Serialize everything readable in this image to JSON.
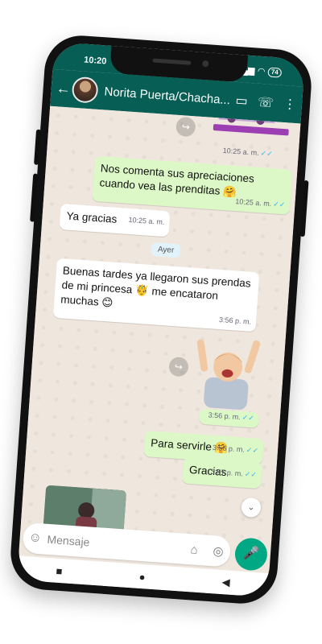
{
  "status": {
    "time": "10:20",
    "battery": "74"
  },
  "header": {
    "title": "Norita Puerta/Chacha..."
  },
  "messages": [
    {
      "text": "",
      "time": "10:25 a. m.",
      "ticks": "✓✓"
    },
    {
      "text": "Nos comenta sus apreciaciones cuando vea las prenditas 🤗",
      "time": "10:25 a. m.",
      "ticks": "✓✓"
    },
    {
      "text": "Ya gracias",
      "time": "10:25 a. m."
    },
    {
      "text": "Buenas tardes ya llegaron sus prendas de mi princesa 🤴 me encataron muchas 😊",
      "time": "3:56 p. m."
    },
    {
      "text": "",
      "time": "3:56 p. m.",
      "ticks": "✓✓"
    },
    {
      "text": "Para servirle 🤗",
      "time": "3:56 p. m.",
      "ticks": "✓✓"
    },
    {
      "text": "Gracias",
      "time": "3:57 p. m.",
      "ticks": "✓✓"
    }
  ],
  "day_separator": "Ayer",
  "input": {
    "placeholder": "Mensaje"
  },
  "nav": {
    "square": "■",
    "circle": "●",
    "back": "◀"
  },
  "icons": {
    "back": "←",
    "video": "▭",
    "call": "☏",
    "menu": "⋮",
    "emoji": "☺",
    "attach": "⌂",
    "camera": "◎",
    "mic": "🎤",
    "forward": "↪",
    "scroll": "⌄"
  }
}
